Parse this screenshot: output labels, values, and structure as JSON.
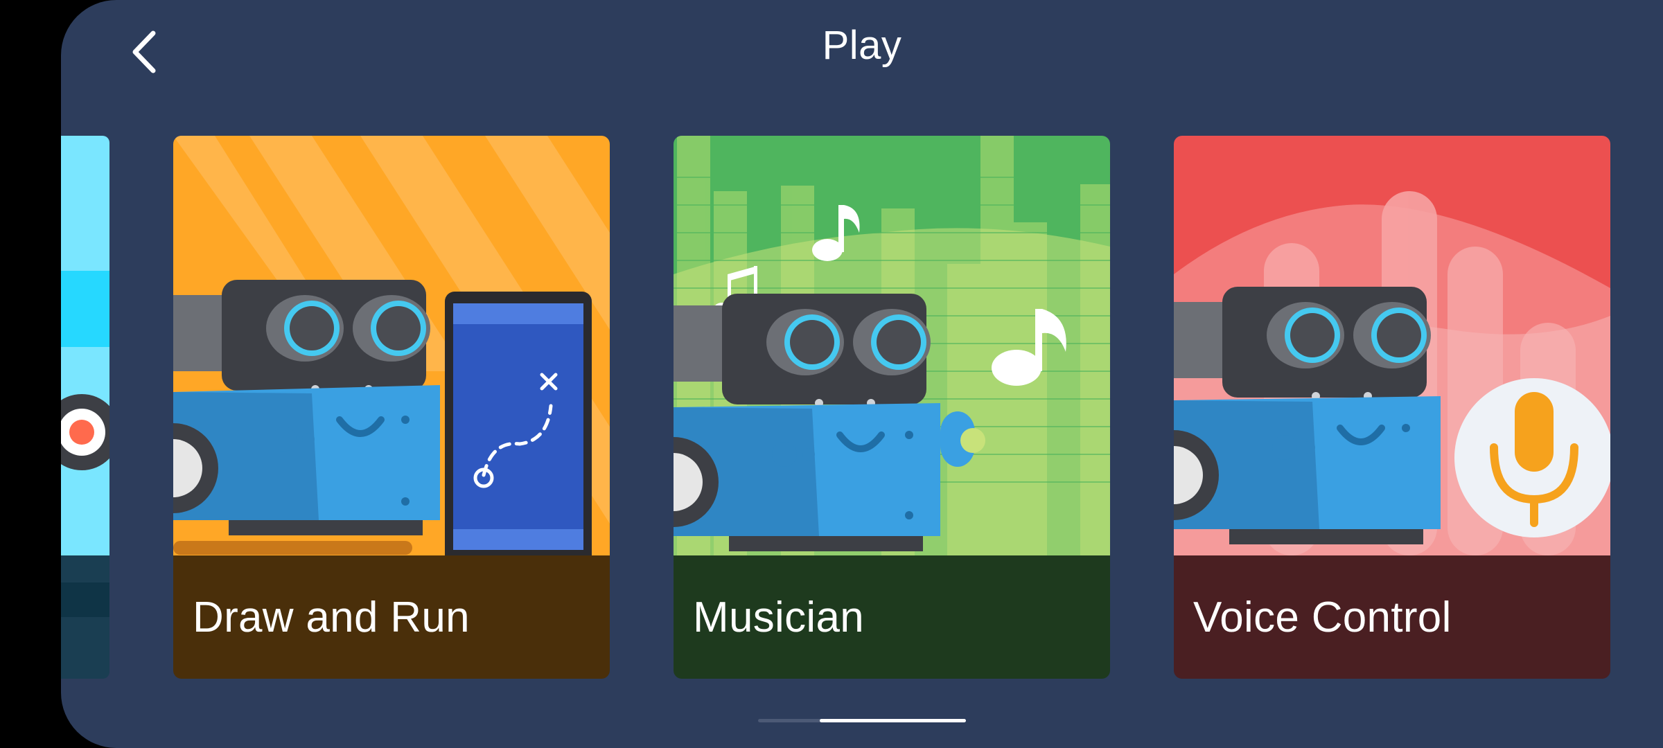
{
  "header": {
    "title": "Play",
    "back_icon": "chevron-left-icon"
  },
  "cards": [
    {
      "label": "Draw and Run",
      "icon": "path-map-icon",
      "color": "#ffa726",
      "band_color": "#4a2f0a"
    },
    {
      "label": "Musician",
      "icon": "music-note-icon",
      "color": "#4fb55e",
      "band_color": "#1e3a1e"
    },
    {
      "label": "Voice Control",
      "icon": "microphone-icon",
      "color": "#ec5050",
      "band_color": "#4a1f22"
    }
  ],
  "colors": {
    "background": "#2d3d5c",
    "robot_body": "#3aa0e2",
    "robot_head": "#3d3f45",
    "eye_ring": "#45c9f0"
  }
}
